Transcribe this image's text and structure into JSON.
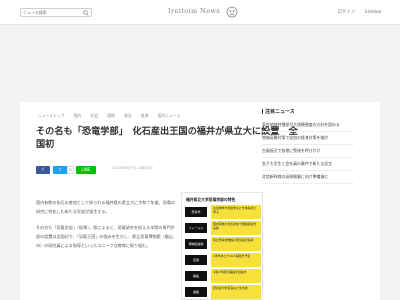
{
  "header": {
    "search_placeholder": "ニュース検索",
    "logo_text": "Ireitoim News",
    "links": [
      "ログイン",
      "Sidebar"
    ]
  },
  "breadcrumb": [
    "ニューストップ",
    "国内",
    "社会",
    "国際",
    "政治",
    "経済",
    "国内ニュース"
  ],
  "article": {
    "title": "その名も「恐竜学部」　化石産出王国の福井が県立大に設置　全国初",
    "date": "2023年6月7日 12時34分",
    "paragraphs": [
      "国内有数の化石の産地として知られる福井県の県立大に令和７年度、恐竜の研究に特化した新たな学部が誕生する。",
      "その名も「恐竜学部」（仮称）。県によると、恐竜研究を担える学際の専門学部の設置は全国初で、「恐竜王国」の強みを生かし、県立恐竜博物館（勝山市）の研究員による指導といったユニークな教育に取り組む。"
    ]
  },
  "share": {
    "facebook": "f",
    "twitter": "t",
    "count": "0",
    "line": "LINE"
  },
  "infographic": {
    "title": "福井県立大学恐竜学部の特色",
    "rows": [
      {
        "label": "恐竜学",
        "text": "古生物学や地質学などを体系的に学ぶ"
      },
      {
        "label": "フィールド",
        "text": "国内有数の化石産地で発掘調査を実施"
      },
      {
        "label": "博物館連携",
        "text": "県立恐竜博物館の研究員が指導"
      },
      {
        "label": "定員",
        "text": "1学年あたり30人程度を予定"
      },
      {
        "label": "開設",
        "text": "令和7年度の開設を目指す"
      },
      {
        "label": "進路",
        "text": "研究者や学芸員などを育成"
      }
    ]
  },
  "sidebar": {
    "heading": "注目ニュース",
    "items": [
      "東京地検特捜部が大規模捜査の方針を固める",
      "物価高騰対策で追加の経済対策を検討",
      "台風接近で各地に警戒を呼びかけ",
      "女子大学生と会社員の事件で新たな証言",
      "北陸新幹線の延伸開業に向け準備進む"
    ]
  },
  "colors": {
    "accent": "#e0502f",
    "facebook": "#3b5998",
    "twitter": "#1da1f2",
    "line": "#00c300",
    "info_highlight": "#f6e03a"
  }
}
